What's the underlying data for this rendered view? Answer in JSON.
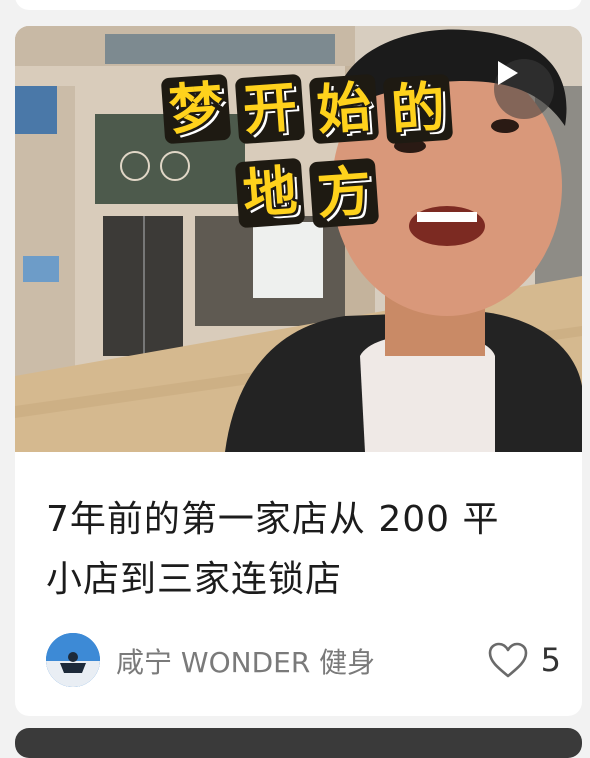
{
  "overlay": {
    "line1": [
      "梦",
      "开",
      "始",
      "的"
    ],
    "line2": [
      "地",
      "方"
    ]
  },
  "card": {
    "title_line1": "7年前的第一家店从 200 平",
    "title_line2": "小店到三家连锁店",
    "author": "咸宁 WONDER 健身",
    "likes": "5"
  },
  "icons": {
    "play": "play-icon",
    "heart": "heart-outline-icon"
  },
  "colors": {
    "overlay_yellow": "#ffd21c",
    "overlay_outline": "#1e1a12",
    "title_text": "#1c1c1c",
    "author_text": "#7a7a7a"
  }
}
